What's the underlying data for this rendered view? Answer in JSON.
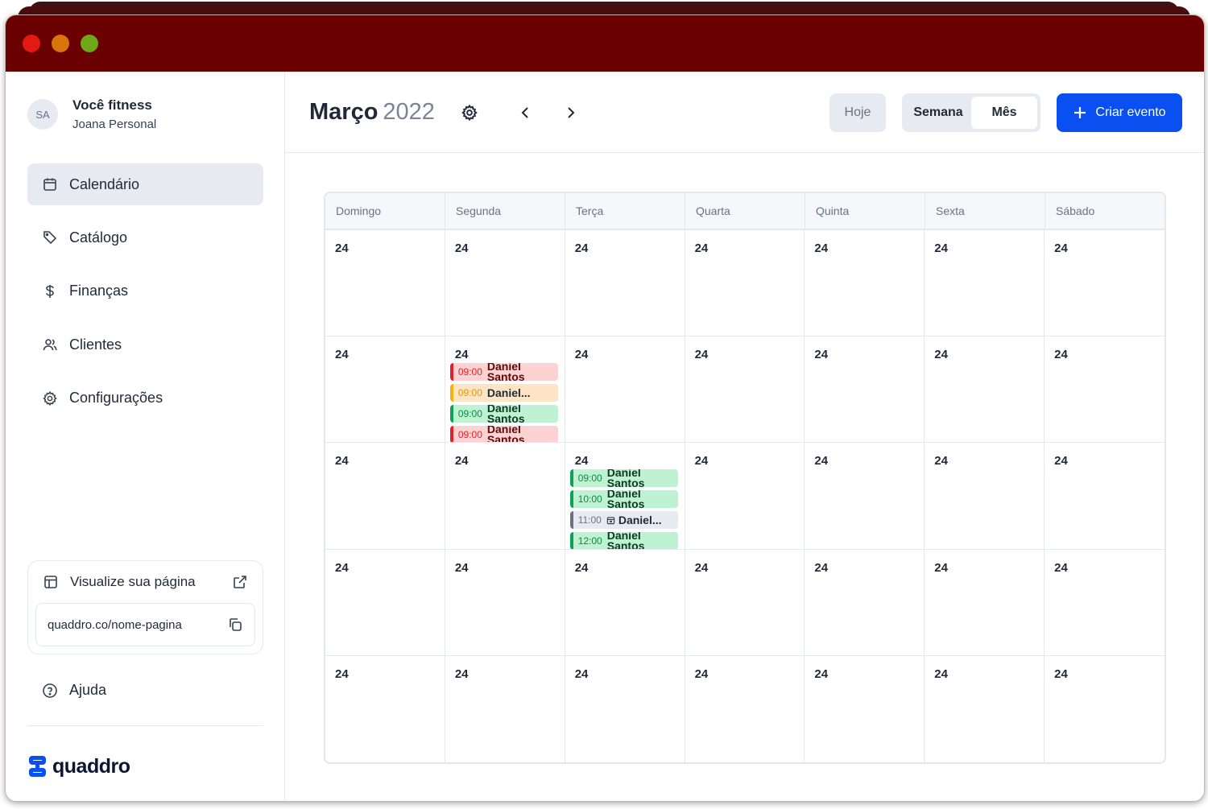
{
  "window": {
    "controls": [
      "close",
      "minimize",
      "zoom"
    ],
    "titlebar_color": "#6b0000"
  },
  "profile": {
    "initials": "SA",
    "name": "Você fitness",
    "subtitle": "Joana Personal"
  },
  "nav": {
    "items": [
      {
        "label": "Calendário",
        "icon": "calendar-icon",
        "active": true
      },
      {
        "label": "Catálogo",
        "icon": "tag-icon",
        "active": false
      },
      {
        "label": "Finanças",
        "icon": "dollar-icon",
        "active": false
      },
      {
        "label": "Clientes",
        "icon": "users-icon",
        "active": false
      },
      {
        "label": "Configurações",
        "icon": "gear-icon",
        "active": false
      }
    ]
  },
  "page_card": {
    "label": "Visualize sua página",
    "url": "quaddro.co/nome-pagina"
  },
  "help": {
    "label": "Ajuda"
  },
  "brand": {
    "name": "quaddro",
    "color": "#0a50f0"
  },
  "header": {
    "month": "Março",
    "year": "2022",
    "today_label": "Hoje",
    "view_week": "Semana",
    "view_month": "Mês",
    "selected_view": "Mês",
    "create_label": "Criar evento",
    "accent": "#0a50f0"
  },
  "calendar": {
    "weekdays": [
      "Domingo",
      "Segunda",
      "Terça",
      "Quarta",
      "Quinta",
      "Sexta",
      "Sábado"
    ],
    "day_label": "24",
    "events": {
      "row1_segunda": [
        {
          "time": "09:00",
          "name": "Daniel Santos",
          "color": "red"
        },
        {
          "time": "09:00",
          "name": "Daniel...",
          "color": "yellow"
        },
        {
          "time": "09:00",
          "name": "Daniel Santos",
          "color": "green"
        },
        {
          "time": "09:00",
          "name": "Daniel Santos",
          "color": "red"
        }
      ],
      "row2_terca": [
        {
          "time": "09:00",
          "name": "Daniel Santos",
          "color": "green"
        },
        {
          "time": "10:00",
          "name": "Daniel Santos",
          "color": "green"
        },
        {
          "time": "11:00",
          "name": "Daniel...",
          "color": "gray",
          "icon": "calendar-small-icon"
        },
        {
          "time": "12:00",
          "name": "Daniel Santos",
          "color": "green"
        }
      ]
    }
  }
}
